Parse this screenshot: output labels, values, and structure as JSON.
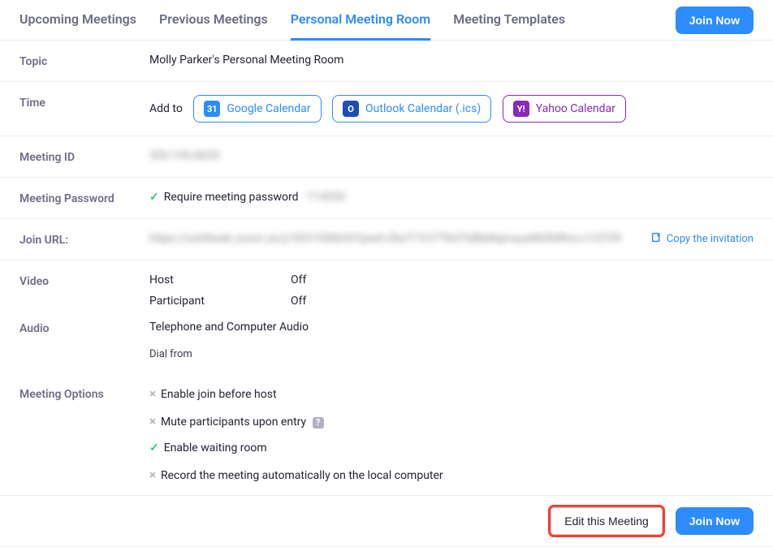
{
  "tabs": {
    "upcoming": "Upcoming Meetings",
    "previous": "Previous Meetings",
    "pmr": "Personal Meeting Room",
    "templates": "Meeting Templates"
  },
  "header": {
    "join_now": "Join Now"
  },
  "rows": {
    "topic_label": "Topic",
    "topic_value": "Molly Parker's Personal Meeting Room",
    "time_label": "Time",
    "addto_label": "Add to",
    "calendar": {
      "google": "Google Calendar",
      "outlook": "Outlook Calendar (.ics)",
      "yahoo": "Yahoo Calendar"
    },
    "meeting_id_label": "Meeting ID",
    "meeting_id_value": "355-195-8635",
    "password_label": "Meeting Password",
    "password_require": "Require meeting password",
    "password_value": "714950",
    "join_url_label": "Join URL:",
    "join_url_value": "https://us04web.zoom.us/j/3551958635?pwd=ZkeT7V27TkQTldBeNqmaueNhfblRmvJ1QT09",
    "copy_invitation": "Copy the invitation",
    "video_label": "Video",
    "video_host_label": "Host",
    "video_host_value": "Off",
    "video_part_label": "Participant",
    "video_part_value": "Off",
    "audio_label": "Audio",
    "audio_value": "Telephone and Computer Audio",
    "dial_from": "Dial from",
    "options_label": "Meeting Options",
    "options": {
      "join_before_host": "Enable join before host",
      "mute_on_entry": "Mute participants upon entry",
      "waiting_room": "Enable waiting room",
      "record_local": "Record the meeting automatically on the local computer"
    }
  },
  "footer": {
    "edit": "Edit this Meeting",
    "join_now": "Join Now"
  },
  "icons": {
    "google_cal": "31",
    "outlook_cal": "O",
    "yahoo_cal": "Y!",
    "question": "?"
  }
}
